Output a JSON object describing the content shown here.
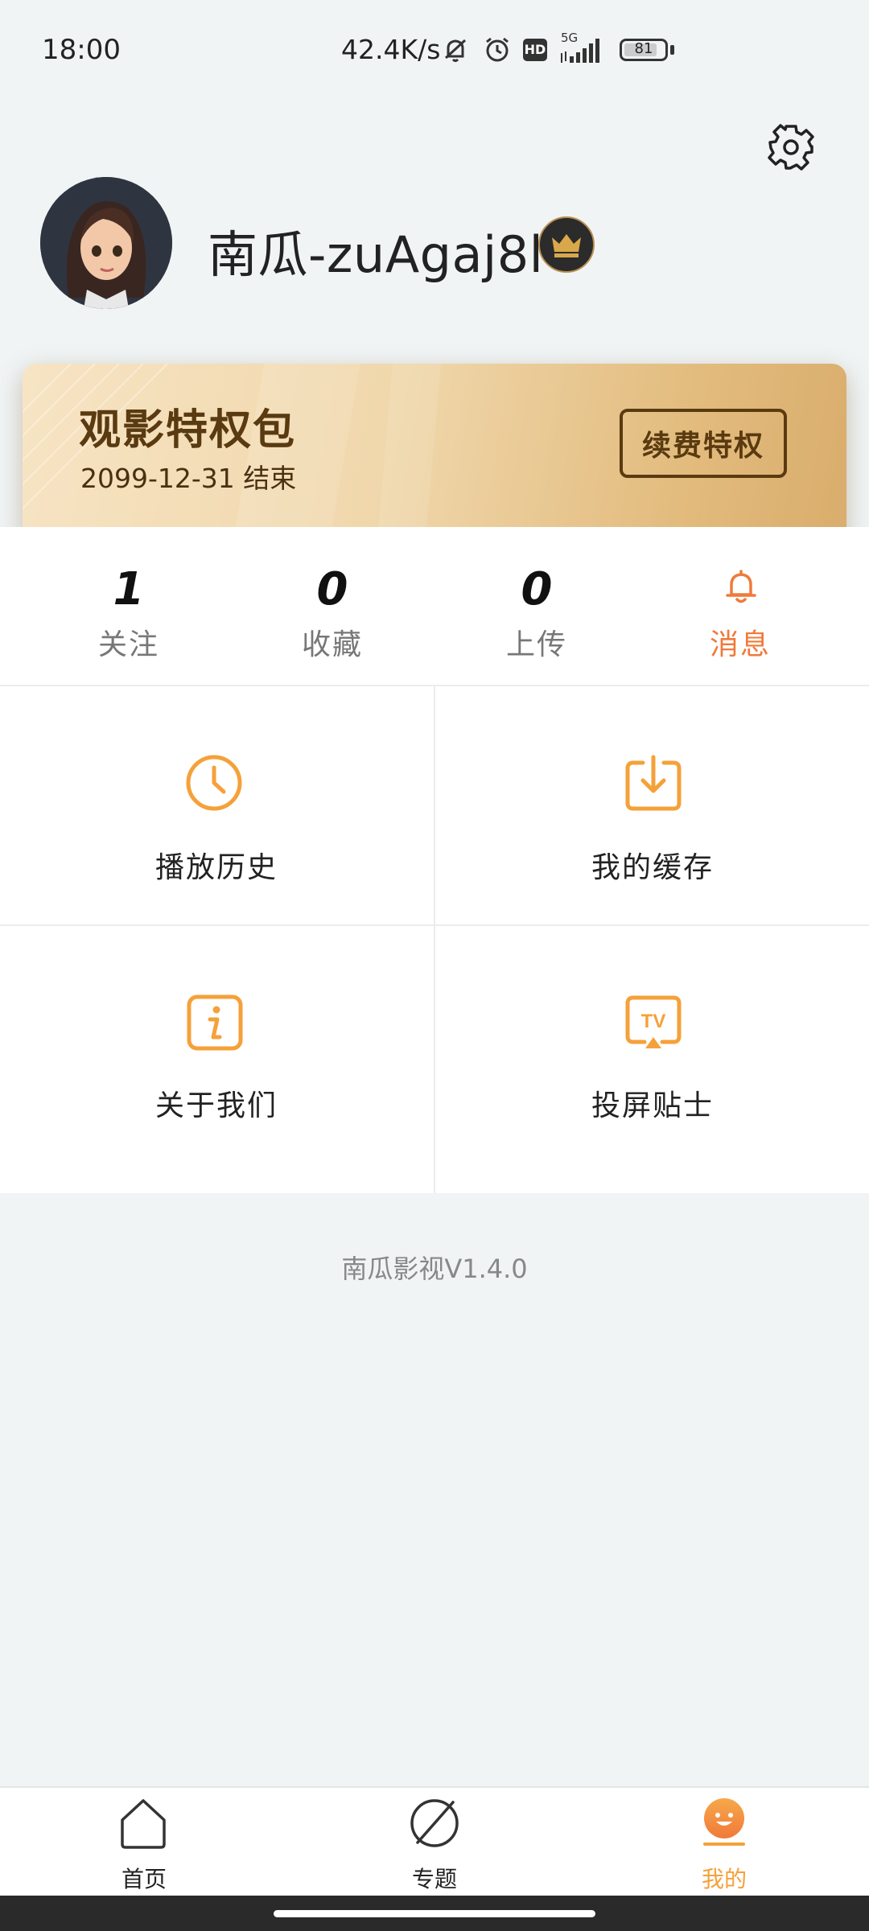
{
  "status_bar": {
    "time": "18:00",
    "net_speed": "42.4K/s",
    "network": "5G",
    "hd": "HD",
    "battery": "81"
  },
  "profile": {
    "username": "南瓜-zuAgaj8l"
  },
  "vip_card": {
    "title": "观影特权包",
    "expiry": "2099-12-31  结束",
    "renew_label": "续费特权"
  },
  "stats": [
    {
      "value": "1",
      "label": "关注"
    },
    {
      "value": "0",
      "label": "收藏"
    },
    {
      "value": "0",
      "label": "上传"
    },
    {
      "label": "消息"
    }
  ],
  "grid": [
    {
      "label": "播放历史",
      "icon": "clock-icon"
    },
    {
      "label": "我的缓存",
      "icon": "download-icon"
    },
    {
      "label": "关于我们",
      "icon": "info-icon"
    },
    {
      "label": "投屏贴士",
      "icon": "tv-icon"
    }
  ],
  "version": "南瓜影视V1.4.0",
  "nav": [
    {
      "label": "首页",
      "icon": "home-icon",
      "active": false
    },
    {
      "label": "专题",
      "icon": "planet-icon",
      "active": false
    },
    {
      "label": "我的",
      "icon": "smile-icon",
      "active": true
    }
  ],
  "colors": {
    "accent": "#f5a13a",
    "message_accent": "#f07a3a",
    "vip_text": "#5a3a10",
    "background": "#f0f4f5"
  }
}
